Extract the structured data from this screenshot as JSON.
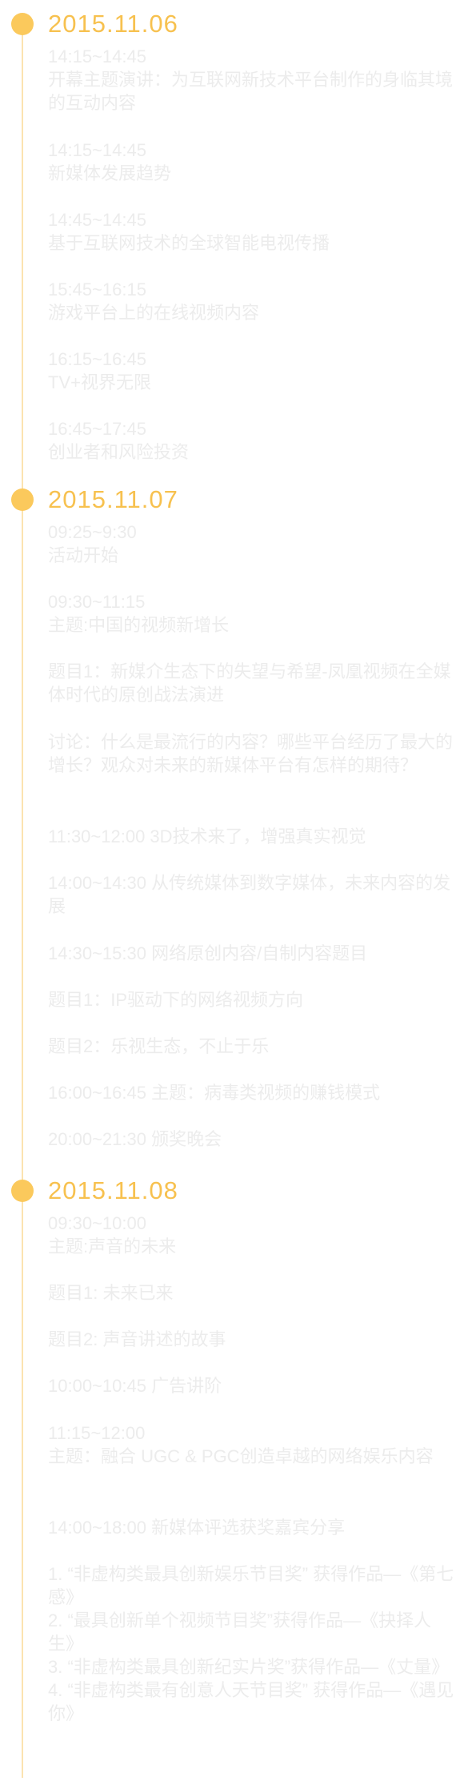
{
  "days": [
    {
      "date": "2015.11.06",
      "items": [
        [
          "14:15~14:45",
          "开幕主题演讲：为互联网新技术平台制作的身临其境的互动内容"
        ],
        [
          "14:15~14:45",
          "新媒体发展趋势"
        ],
        [
          "14:45~14:45",
          "基于互联网技术的全球智能电视传播"
        ],
        [
          "15:45~16:15",
          "游戏平台上的在线视频内容"
        ],
        [
          "16:15~16:45",
          "TV+视界无限"
        ],
        [
          "16:45~17:45",
          "创业者和风险投资"
        ]
      ]
    },
    {
      "date": "2015.11.07",
      "items": [
        [
          "09:25~9:30",
          "活动开始"
        ],
        [
          "09:30~11:15",
          "主题:中国的视频新增长"
        ],
        [
          "题目1：新媒介生态下的失望与希望-凤凰视频在全媒体时代的原创战法演进"
        ],
        [
          "讨论：什么是最流行的内容？哪些平台经历了最大的增长？观众对未来的新媒体平台有怎样的期待？"
        ],
        [
          "11:30~12:00 3D技术来了，增强真实视觉"
        ],
        [
          "14:00~14:30 从传统媒体到数字媒体，未来内容的发展"
        ],
        [
          "14:30~15:30 网络原创内容/自制内容题目"
        ],
        [
          "题目1：IP驱动下的网络视频方向"
        ],
        [
          "题目2：乐视生态，不止于乐"
        ],
        [
          "16:00~16:45 主题：病毒类视频的赚钱模式"
        ],
        [
          "20:00~21:30 颁奖晚会"
        ]
      ]
    },
    {
      "date": "2015.11.08",
      "items": [
        [
          "09:30~10:00",
          "主题:声音的未来"
        ],
        [
          "题目1: 未来已来"
        ],
        [
          "题目2: 声音讲述的故事"
        ],
        [
          "10:00~10:45 广告讲阶"
        ],
        [
          "11:15~12:00",
          "主题：融合 UGC & PGC创造卓越的网络娱乐内容"
        ],
        [
          "14:00~18:00 新媒体评选获奖嘉宾分享"
        ],
        [
          "1. “非虚构类最具创新娱乐节目奖” 获得作品—《第七感》",
          "2. “最具创新单个视频节目奖”获得作品—《抉择人生》",
          "3. “非虚构类最具创新纪实片奖”获得作品—《丈量》",
          "4. “非虚构类最有创意人天节目奖” 获得作品—《遇见你》"
        ]
      ]
    }
  ]
}
